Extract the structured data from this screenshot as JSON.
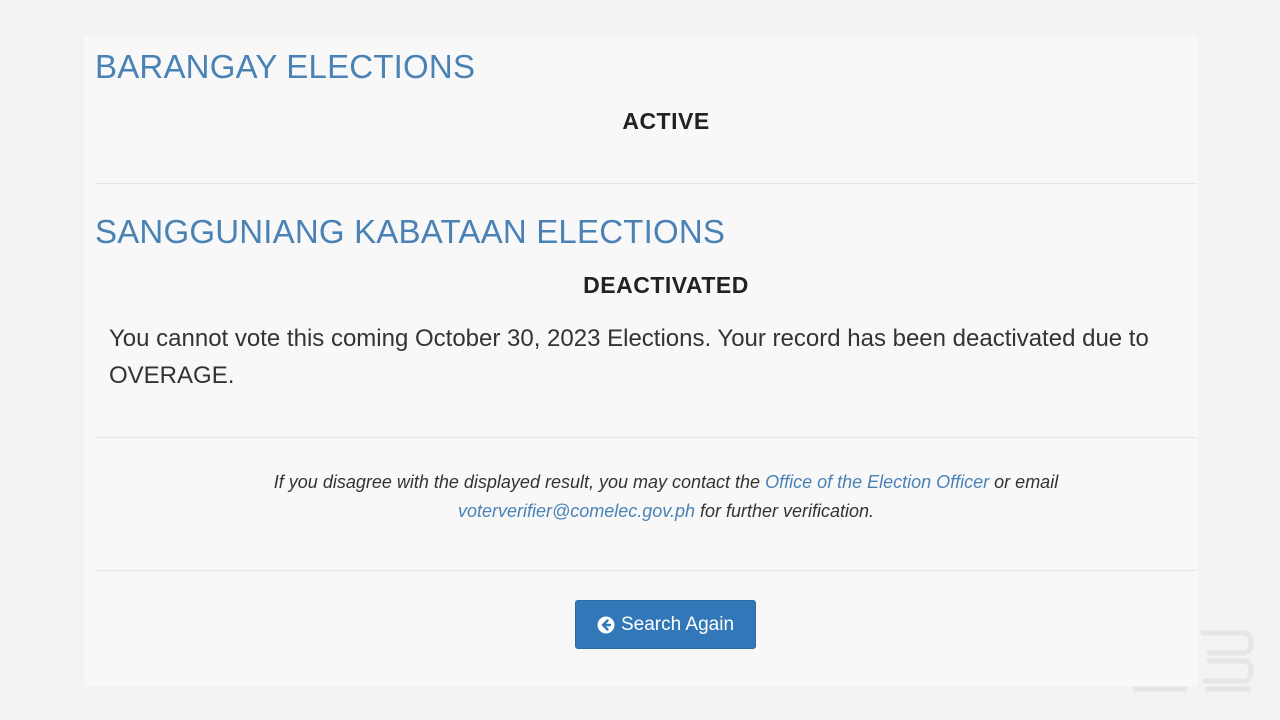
{
  "barangay": {
    "title": "BARANGAY ELECTIONS",
    "status": "ACTIVE"
  },
  "sk": {
    "title": "SANGGUNIANG KABATAAN ELECTIONS",
    "status": "DEACTIVATED",
    "message": "You cannot vote this coming October 30, 2023 Elections. Your record has been deactivated due to OVERAGE."
  },
  "note": {
    "text_before": "If you disagree with the displayed result, you may contact the ",
    "office_link": "Office of the Election Officer",
    "text_middle": " or email",
    "email_link": "voterverifier@comelec.gov.ph",
    "text_after": " for further verification."
  },
  "actions": {
    "search_again_label": "Search Again",
    "search_again_icon": "arrow-circle-left-icon"
  },
  "colors": {
    "title": "#4a82b6",
    "button": "#3277b7",
    "link": "#4a82b6"
  }
}
